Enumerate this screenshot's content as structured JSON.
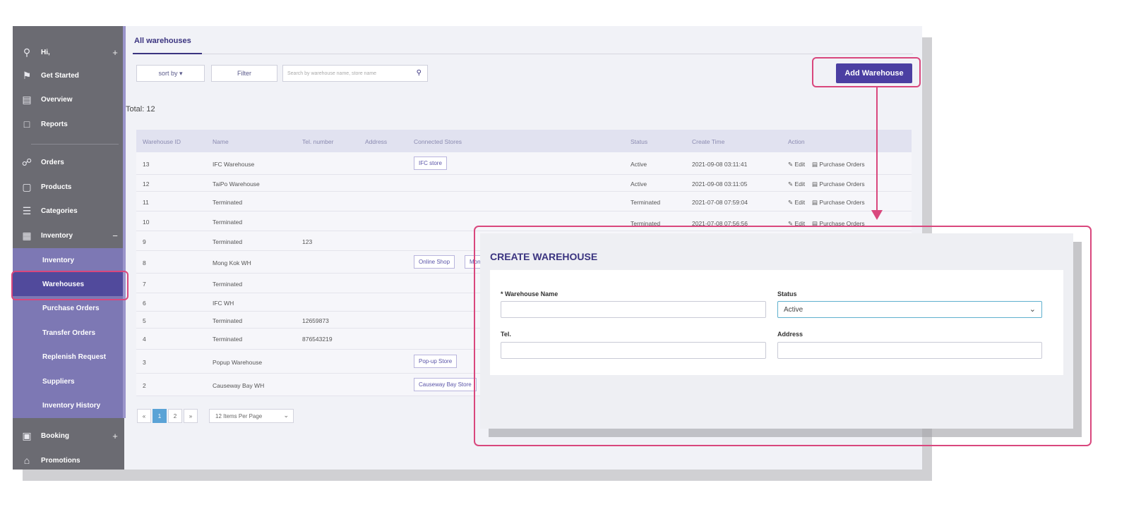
{
  "sidebar": {
    "items": [
      {
        "icon": "user-icon",
        "label": "Hi,",
        "extra": "+"
      },
      {
        "icon": "flag-icon",
        "label": "Get Started"
      },
      {
        "icon": "chart-icon",
        "label": "Overview"
      },
      {
        "icon": "file-icon",
        "label": "Reports"
      },
      {
        "icon": "cart-icon",
        "label": "Orders"
      },
      {
        "icon": "bag-icon",
        "label": "Products"
      },
      {
        "icon": "list-icon",
        "label": "Categories"
      },
      {
        "icon": "boxes-icon",
        "label": "Inventory",
        "extra": "−"
      }
    ],
    "sub_items": [
      {
        "label": "Inventory"
      },
      {
        "label": "Warehouses"
      },
      {
        "label": "Purchase Orders"
      },
      {
        "label": "Transfer Orders"
      },
      {
        "label": "Replenish Request"
      },
      {
        "label": "Suppliers"
      },
      {
        "label": "Inventory History"
      }
    ],
    "bottom_items": [
      {
        "icon": "calendar-icon",
        "label": "Booking",
        "extra": "+"
      },
      {
        "icon": "tag-icon",
        "label": "Promotions"
      }
    ]
  },
  "tabs": {
    "all": "All warehouses"
  },
  "toolbar": {
    "sort_label": "sort by ▾",
    "filter_label": "Filter",
    "search_placeholder": "Search by warehouse name, store name",
    "add_label": "Add Warehouse"
  },
  "total": "Total: 12",
  "table": {
    "headers": [
      "Warehouse ID",
      "Name",
      "Tel. number",
      "Address",
      "Connected Stores",
      "Status",
      "Create Time",
      "Action"
    ],
    "rows": [
      {
        "id": "13",
        "name": "IFC Warehouse",
        "tel": "",
        "stores": [
          "IFC store"
        ],
        "status": "Active",
        "created": "2021-09-08 03:11:41",
        "edit": "Edit",
        "po": "Purchase Orders"
      },
      {
        "id": "12",
        "name": "TaiPo Warehouse",
        "tel": "",
        "stores": [],
        "status": "Active",
        "created": "2021-09-08 03:11:05",
        "edit": "Edit",
        "po": "Purchase Orders"
      },
      {
        "id": "11",
        "name": "Terminated",
        "tel": "",
        "stores": [],
        "status": "Terminated",
        "created": "2021-07-08 07:59:04",
        "edit": "Edit",
        "po": "Purchase Orders"
      },
      {
        "id": "10",
        "name": "Terminated",
        "tel": "",
        "stores": [],
        "status": "Terminated",
        "created": "2021-07-08 07:56:56",
        "edit": "Edit",
        "po": "Purchase Orders"
      },
      {
        "id": "9",
        "name": "Terminated",
        "tel": "123",
        "stores": [],
        "status": "",
        "created": "",
        "edit": "",
        "po": ""
      },
      {
        "id": "8",
        "name": "Mong Kok WH",
        "tel": "",
        "stores": [
          "Online Shop",
          "Mon"
        ],
        "status": "",
        "created": "",
        "edit": "",
        "po": ""
      },
      {
        "id": "7",
        "name": "Terminated",
        "tel": "",
        "stores": [],
        "status": "",
        "created": "",
        "edit": "",
        "po": ""
      },
      {
        "id": "6",
        "name": "IFC WH",
        "tel": "",
        "stores": [],
        "status": "",
        "created": "",
        "edit": "",
        "po": ""
      },
      {
        "id": "5",
        "name": "Terminated",
        "tel": "12659873",
        "stores": [],
        "status": "",
        "created": "",
        "edit": "",
        "po": ""
      },
      {
        "id": "4",
        "name": "Terminated",
        "tel": "876543219",
        "stores": [],
        "status": "",
        "created": "",
        "edit": "",
        "po": ""
      },
      {
        "id": "3",
        "name": "Popup Warehouse",
        "tel": "",
        "stores": [
          "Pop-up Store"
        ],
        "status": "",
        "created": "",
        "edit": "",
        "po": ""
      },
      {
        "id": "2",
        "name": "Causeway Bay WH",
        "tel": "",
        "stores": [
          "Causeway Bay Store"
        ],
        "status": "",
        "created": "",
        "edit": "",
        "po": ""
      }
    ]
  },
  "pagination": {
    "prev": "«",
    "pages": [
      "1",
      "2"
    ],
    "current": "1",
    "next": "»",
    "per_page": "12 Items Per Page"
  },
  "modal": {
    "title": "CREATE WAREHOUSE",
    "name_label": "* Warehouse Name",
    "status_label": "Status",
    "status_value": "Active",
    "tel_label": "Tel.",
    "address_label": "Address"
  },
  "colors": {
    "accent": "#4b3fa2",
    "highlight": "#d9477d",
    "sidebar": "#6b6b72",
    "submenu": "#7d78b4",
    "submenu_active": "#514a9c"
  }
}
